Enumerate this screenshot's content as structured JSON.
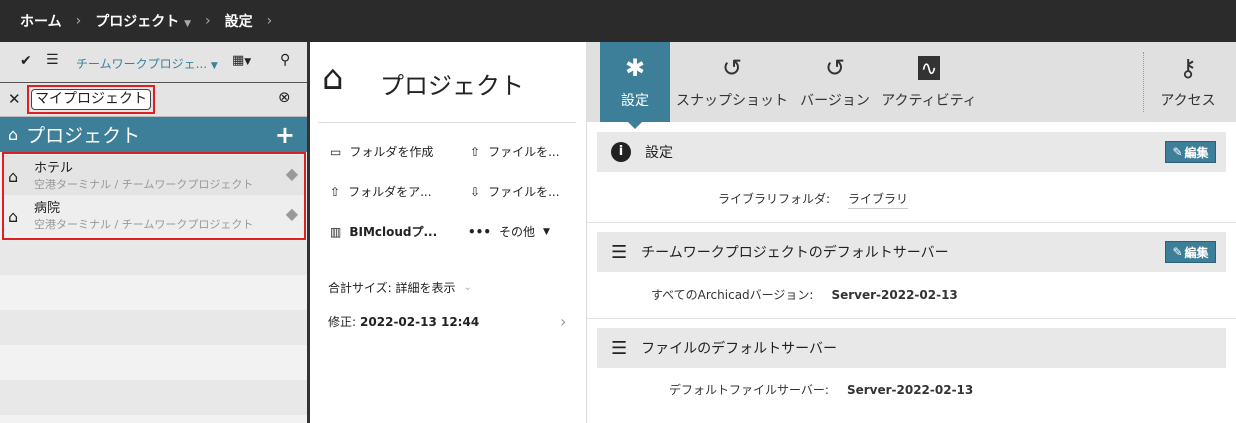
{
  "breadcrumb": {
    "home": "ホーム",
    "project": "プロジェクト",
    "settings": "設定"
  },
  "left": {
    "filter_dropdown": "チームワークプロジェ...",
    "search_value": "マイプロジェクト",
    "header": "プロジェクト",
    "items": [
      {
        "title": "ホテル",
        "path": "空港ターミナル / チームワークプロジェクト"
      },
      {
        "title": "病院",
        "path": "空港ターミナル / チームワークプロジェクト"
      }
    ]
  },
  "middle": {
    "title": "プロジェクト",
    "actions": {
      "create_folder": "フォルダを作成",
      "upload_file": "ファイルを...",
      "upload_folder": "フォルダをア...",
      "download_file": "ファイルを...",
      "bimcloud": "BIMcloudプ...",
      "more": "その他"
    },
    "total_size": "合計サイズ: 詳細を表示",
    "modified_label": "修正:",
    "modified_value": "2022-02-13 12:44"
  },
  "right": {
    "tabs": [
      "設定",
      "スナップショット",
      "バージョン",
      "アクティビティ",
      "アクセス"
    ],
    "sections": [
      {
        "title": "設定",
        "edit": "編集",
        "label": "ライブラリフォルダ:",
        "value": "ライブラリ"
      },
      {
        "title": "チームワークプロジェクトのデフォルトサーバー",
        "edit": "編集",
        "label": "すべてのArchicadバージョン:",
        "value": "Server-2022-02-13"
      },
      {
        "title": "ファイルのデフォルトサーバー",
        "label": "デフォルトファイルサーバー:",
        "value": "Server-2022-02-13"
      }
    ]
  },
  "colors": {
    "accent": "#3d7f99",
    "topbar": "#2b2b2b",
    "highlight": "#e02020"
  }
}
